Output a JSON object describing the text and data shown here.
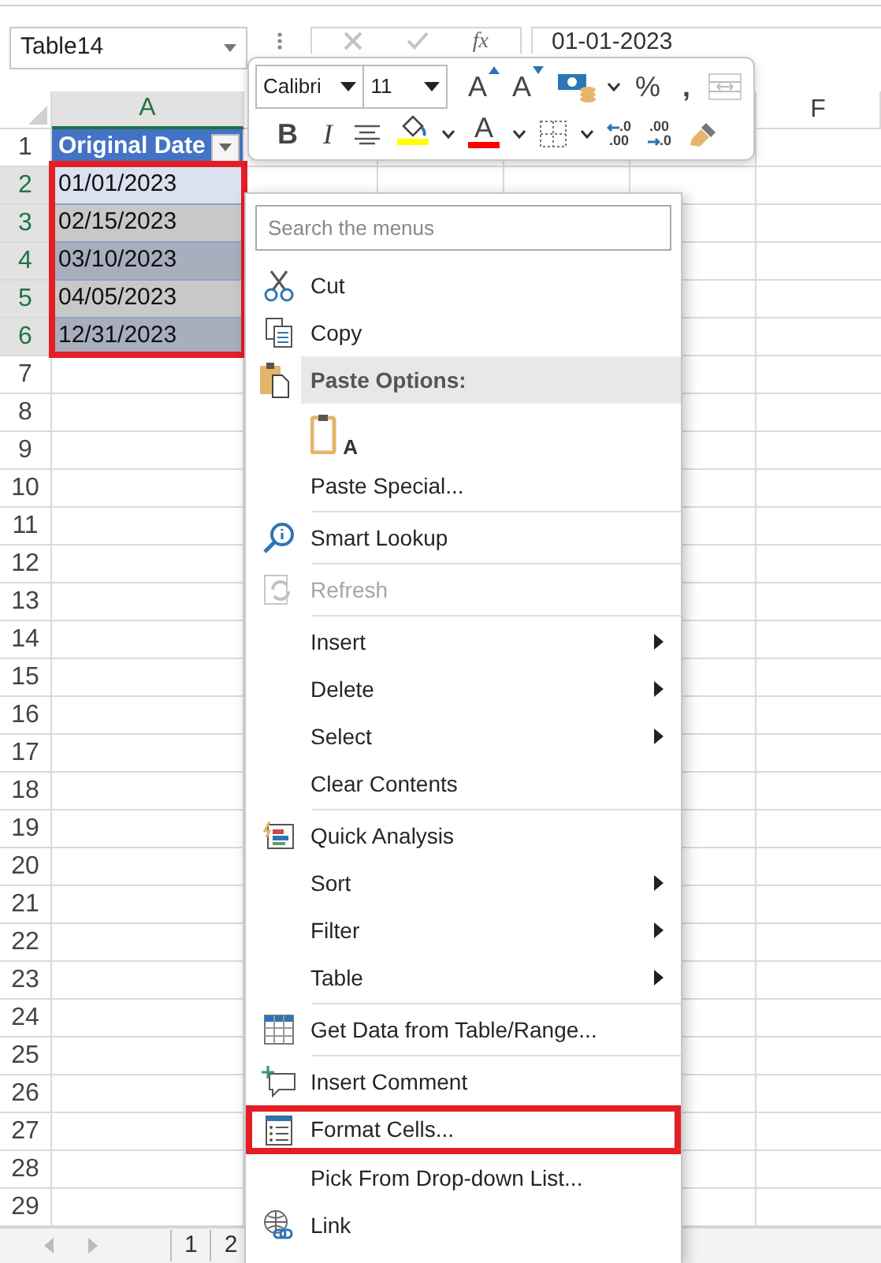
{
  "formula_bar": {
    "name_box": "Table14",
    "fx": "fx",
    "value": "01-01-2023"
  },
  "columns": [
    {
      "label": "A",
      "selected": true
    },
    {
      "label": "F",
      "selected": false
    }
  ],
  "row_numbers": [
    {
      "label": "1",
      "selected": false
    },
    {
      "label": "2",
      "selected": true
    },
    {
      "label": "3",
      "selected": true
    },
    {
      "label": "4",
      "selected": true
    },
    {
      "label": "5",
      "selected": true
    },
    {
      "label": "6",
      "selected": true
    },
    {
      "label": "7",
      "selected": false
    },
    {
      "label": "8",
      "selected": false
    },
    {
      "label": "9",
      "selected": false
    },
    {
      "label": "10",
      "selected": false
    },
    {
      "label": "11",
      "selected": false
    },
    {
      "label": "12",
      "selected": false
    },
    {
      "label": "13",
      "selected": false
    },
    {
      "label": "14",
      "selected": false
    },
    {
      "label": "15",
      "selected": false
    },
    {
      "label": "16",
      "selected": false
    },
    {
      "label": "17",
      "selected": false
    },
    {
      "label": "18",
      "selected": false
    },
    {
      "label": "19",
      "selected": false
    },
    {
      "label": "20",
      "selected": false
    },
    {
      "label": "21",
      "selected": false
    },
    {
      "label": "22",
      "selected": false
    },
    {
      "label": "23",
      "selected": false
    },
    {
      "label": "24",
      "selected": false
    },
    {
      "label": "25",
      "selected": false
    },
    {
      "label": "26",
      "selected": false
    },
    {
      "label": "27",
      "selected": false
    },
    {
      "label": "28",
      "selected": false
    },
    {
      "label": "29",
      "selected": false
    }
  ],
  "table": {
    "header": "Original Date",
    "filter": true,
    "highlighted": true,
    "rows": [
      {
        "value": "01/01/2023",
        "active": true
      },
      {
        "value": "02/15/2023",
        "active": false
      },
      {
        "value": "03/10/2023",
        "active": false
      },
      {
        "value": "04/05/2023",
        "active": false
      },
      {
        "value": "12/31/2023",
        "active": false
      }
    ]
  },
  "mini_toolbar": {
    "font": "Calibri",
    "size": "11",
    "row1": [
      {
        "kind": "grow-font",
        "glyph": "A"
      },
      {
        "kind": "shrink-font",
        "glyph": "A"
      },
      {
        "kind": "accounting"
      },
      {
        "kind": "percent",
        "glyph": "%"
      },
      {
        "kind": "comma",
        "glyph": ","
      },
      {
        "kind": "merge"
      }
    ],
    "row2": [
      {
        "kind": "bold",
        "glyph": "B"
      },
      {
        "kind": "italic",
        "glyph": "I"
      },
      {
        "kind": "center"
      },
      {
        "kind": "fill-color",
        "color": "#ffff00"
      },
      {
        "kind": "font-color",
        "glyph": "A",
        "color": "#ff0000"
      },
      {
        "kind": "borders"
      },
      {
        "kind": "increase-decimal",
        "top": ".0",
        "bottom": ".00"
      },
      {
        "kind": "decrease-decimal",
        "top": ".00",
        "bottom": ".0"
      },
      {
        "kind": "format-painter"
      }
    ]
  },
  "context_menu": [
    {
      "kind": "search",
      "placeholder": "Search the menus"
    },
    {
      "kind": "item",
      "label": "Cut",
      "disabled": false,
      "submenu": false,
      "highlighted": false
    },
    {
      "kind": "item",
      "label": "Copy",
      "disabled": false,
      "submenu": false,
      "highlighted": false
    },
    {
      "kind": "header",
      "label": "Paste Options:"
    },
    {
      "kind": "paste-options",
      "glyph": "A"
    },
    {
      "kind": "item",
      "label": "Paste Special...",
      "disabled": false,
      "submenu": false,
      "highlighted": false
    },
    {
      "kind": "separator"
    },
    {
      "kind": "item",
      "label": "Smart Lookup",
      "disabled": false,
      "submenu": false,
      "highlighted": false
    },
    {
      "kind": "separator"
    },
    {
      "kind": "item",
      "label": "Refresh",
      "disabled": true,
      "submenu": false,
      "highlighted": false
    },
    {
      "kind": "separator"
    },
    {
      "kind": "item",
      "label": "Insert",
      "disabled": false,
      "submenu": true,
      "highlighted": false
    },
    {
      "kind": "item",
      "label": "Delete",
      "disabled": false,
      "submenu": true,
      "highlighted": false
    },
    {
      "kind": "item",
      "label": "Select",
      "disabled": false,
      "submenu": true,
      "highlighted": false
    },
    {
      "kind": "item",
      "label": "Clear Contents",
      "disabled": false,
      "submenu": false,
      "highlighted": false
    },
    {
      "kind": "separator"
    },
    {
      "kind": "item",
      "label": "Quick Analysis",
      "disabled": false,
      "submenu": false,
      "highlighted": false
    },
    {
      "kind": "item",
      "label": "Sort",
      "disabled": false,
      "submenu": true,
      "highlighted": false
    },
    {
      "kind": "item",
      "label": "Filter",
      "disabled": false,
      "submenu": true,
      "highlighted": false
    },
    {
      "kind": "item",
      "label": "Table",
      "disabled": false,
      "submenu": true,
      "highlighted": false
    },
    {
      "kind": "separator"
    },
    {
      "kind": "item",
      "label": "Get Data from Table/Range...",
      "disabled": false,
      "submenu": false,
      "highlighted": false
    },
    {
      "kind": "separator"
    },
    {
      "kind": "item",
      "label": "Insert Comment",
      "disabled": false,
      "submenu": false,
      "highlighted": false
    },
    {
      "kind": "item",
      "label": "Format Cells...",
      "disabled": false,
      "submenu": false,
      "highlighted": true
    },
    {
      "kind": "item",
      "label": "Pick From Drop-down List...",
      "disabled": false,
      "submenu": false,
      "highlighted": false
    },
    {
      "kind": "item",
      "label": "Link",
      "disabled": false,
      "submenu": false,
      "highlighted": false
    }
  ],
  "sheet_tabs": [
    {
      "label": "1"
    },
    {
      "label": "2"
    }
  ]
}
